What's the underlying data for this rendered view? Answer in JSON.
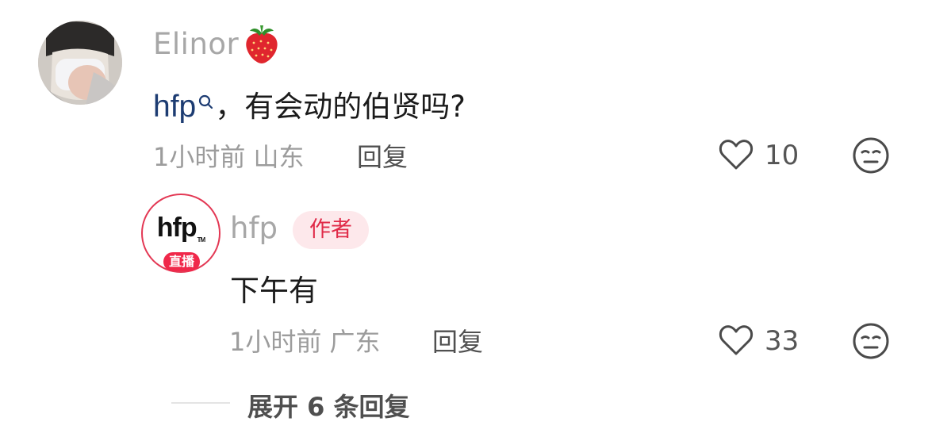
{
  "comment": {
    "username": "Elinor",
    "badge_icon": "strawberry-icon",
    "mention": "hfp",
    "text": "，有会动的伯贤吗?",
    "meta": "1小时前 山东",
    "reply_label": "回复",
    "like_count": "10",
    "reaction_icon": "neutral-face-icon"
  },
  "reply": {
    "username": "hfp",
    "author_tag": "作者",
    "avatar_logo": "hfp",
    "avatar_tm": "TM",
    "live_badge": "直播",
    "text": "下午有",
    "meta": "1小时前 广东",
    "reply_label": "回复",
    "like_count": "33",
    "reaction_icon": "neutral-face-icon"
  },
  "expand": {
    "label": "展开 6 条回复"
  },
  "colors": {
    "mention": "#1d3c72",
    "author_tag_bg": "#fde8eb",
    "author_tag_text": "#e02a48",
    "live_badge": "#f0284a"
  }
}
